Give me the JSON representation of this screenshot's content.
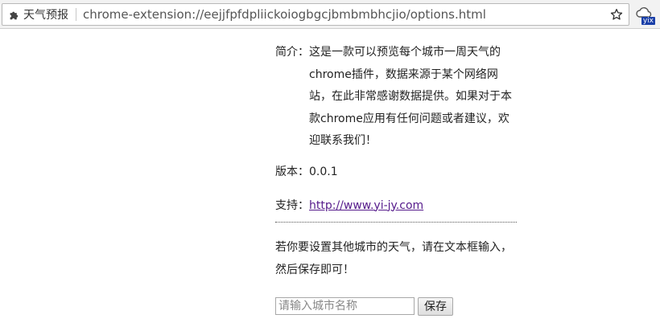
{
  "browser": {
    "extension_name": "天气预报",
    "url": "chrome-extension://eejjfpfdpliickoiogbgcjbmbmbhcjio/options.html",
    "action_badge": "yix",
    "icons": {
      "extension": "puzzle-icon",
      "bookmark": "star-icon",
      "action": "cloud-icon"
    }
  },
  "intro": {
    "label": "简介：",
    "text": "这是一款可以预览每个城市一周天气的chrome插件，数据来源于某个网络网站，在此非常感谢数据提供。如果对于本款chrome应用有任何问题或者建议，欢迎联系我们！"
  },
  "version": {
    "label": "版本：",
    "value": "0.0.1"
  },
  "support": {
    "label": "支持：",
    "link_text": "http://www.yi-jy.com"
  },
  "setting": {
    "hint": "若你要设置其他城市的天气，请在文本框输入，然后保存即可！",
    "input_value": "",
    "input_placeholder": "请输入城市名称",
    "save_label": "保存"
  },
  "colors": {
    "link": "#551a8b",
    "badge": "#1a3fa8"
  }
}
